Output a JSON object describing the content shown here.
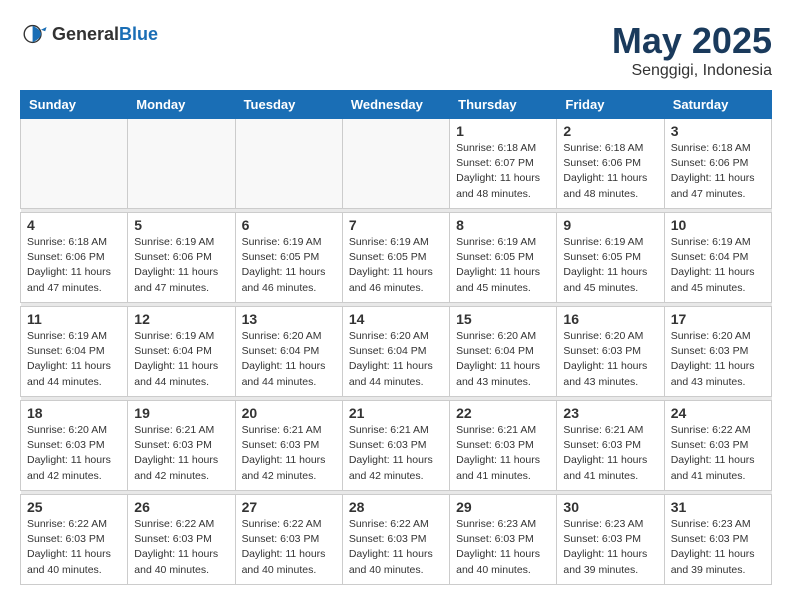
{
  "header": {
    "logo_general": "General",
    "logo_blue": "Blue",
    "month": "May 2025",
    "location": "Senggigi, Indonesia"
  },
  "weekdays": [
    "Sunday",
    "Monday",
    "Tuesday",
    "Wednesday",
    "Thursday",
    "Friday",
    "Saturday"
  ],
  "weeks": [
    {
      "days": [
        {
          "num": "",
          "info": ""
        },
        {
          "num": "",
          "info": ""
        },
        {
          "num": "",
          "info": ""
        },
        {
          "num": "",
          "info": ""
        },
        {
          "num": "1",
          "info": "Sunrise: 6:18 AM\nSunset: 6:07 PM\nDaylight: 11 hours\nand 48 minutes."
        },
        {
          "num": "2",
          "info": "Sunrise: 6:18 AM\nSunset: 6:06 PM\nDaylight: 11 hours\nand 48 minutes."
        },
        {
          "num": "3",
          "info": "Sunrise: 6:18 AM\nSunset: 6:06 PM\nDaylight: 11 hours\nand 47 minutes."
        }
      ]
    },
    {
      "days": [
        {
          "num": "4",
          "info": "Sunrise: 6:18 AM\nSunset: 6:06 PM\nDaylight: 11 hours\nand 47 minutes."
        },
        {
          "num": "5",
          "info": "Sunrise: 6:19 AM\nSunset: 6:06 PM\nDaylight: 11 hours\nand 47 minutes."
        },
        {
          "num": "6",
          "info": "Sunrise: 6:19 AM\nSunset: 6:05 PM\nDaylight: 11 hours\nand 46 minutes."
        },
        {
          "num": "7",
          "info": "Sunrise: 6:19 AM\nSunset: 6:05 PM\nDaylight: 11 hours\nand 46 minutes."
        },
        {
          "num": "8",
          "info": "Sunrise: 6:19 AM\nSunset: 6:05 PM\nDaylight: 11 hours\nand 45 minutes."
        },
        {
          "num": "9",
          "info": "Sunrise: 6:19 AM\nSunset: 6:05 PM\nDaylight: 11 hours\nand 45 minutes."
        },
        {
          "num": "10",
          "info": "Sunrise: 6:19 AM\nSunset: 6:04 PM\nDaylight: 11 hours\nand 45 minutes."
        }
      ]
    },
    {
      "days": [
        {
          "num": "11",
          "info": "Sunrise: 6:19 AM\nSunset: 6:04 PM\nDaylight: 11 hours\nand 44 minutes."
        },
        {
          "num": "12",
          "info": "Sunrise: 6:19 AM\nSunset: 6:04 PM\nDaylight: 11 hours\nand 44 minutes."
        },
        {
          "num": "13",
          "info": "Sunrise: 6:20 AM\nSunset: 6:04 PM\nDaylight: 11 hours\nand 44 minutes."
        },
        {
          "num": "14",
          "info": "Sunrise: 6:20 AM\nSunset: 6:04 PM\nDaylight: 11 hours\nand 44 minutes."
        },
        {
          "num": "15",
          "info": "Sunrise: 6:20 AM\nSunset: 6:04 PM\nDaylight: 11 hours\nand 43 minutes."
        },
        {
          "num": "16",
          "info": "Sunrise: 6:20 AM\nSunset: 6:03 PM\nDaylight: 11 hours\nand 43 minutes."
        },
        {
          "num": "17",
          "info": "Sunrise: 6:20 AM\nSunset: 6:03 PM\nDaylight: 11 hours\nand 43 minutes."
        }
      ]
    },
    {
      "days": [
        {
          "num": "18",
          "info": "Sunrise: 6:20 AM\nSunset: 6:03 PM\nDaylight: 11 hours\nand 42 minutes."
        },
        {
          "num": "19",
          "info": "Sunrise: 6:21 AM\nSunset: 6:03 PM\nDaylight: 11 hours\nand 42 minutes."
        },
        {
          "num": "20",
          "info": "Sunrise: 6:21 AM\nSunset: 6:03 PM\nDaylight: 11 hours\nand 42 minutes."
        },
        {
          "num": "21",
          "info": "Sunrise: 6:21 AM\nSunset: 6:03 PM\nDaylight: 11 hours\nand 42 minutes."
        },
        {
          "num": "22",
          "info": "Sunrise: 6:21 AM\nSunset: 6:03 PM\nDaylight: 11 hours\nand 41 minutes."
        },
        {
          "num": "23",
          "info": "Sunrise: 6:21 AM\nSunset: 6:03 PM\nDaylight: 11 hours\nand 41 minutes."
        },
        {
          "num": "24",
          "info": "Sunrise: 6:22 AM\nSunset: 6:03 PM\nDaylight: 11 hours\nand 41 minutes."
        }
      ]
    },
    {
      "days": [
        {
          "num": "25",
          "info": "Sunrise: 6:22 AM\nSunset: 6:03 PM\nDaylight: 11 hours\nand 40 minutes."
        },
        {
          "num": "26",
          "info": "Sunrise: 6:22 AM\nSunset: 6:03 PM\nDaylight: 11 hours\nand 40 minutes."
        },
        {
          "num": "27",
          "info": "Sunrise: 6:22 AM\nSunset: 6:03 PM\nDaylight: 11 hours\nand 40 minutes."
        },
        {
          "num": "28",
          "info": "Sunrise: 6:22 AM\nSunset: 6:03 PM\nDaylight: 11 hours\nand 40 minutes."
        },
        {
          "num": "29",
          "info": "Sunrise: 6:23 AM\nSunset: 6:03 PM\nDaylight: 11 hours\nand 40 minutes."
        },
        {
          "num": "30",
          "info": "Sunrise: 6:23 AM\nSunset: 6:03 PM\nDaylight: 11 hours\nand 39 minutes."
        },
        {
          "num": "31",
          "info": "Sunrise: 6:23 AM\nSunset: 6:03 PM\nDaylight: 11 hours\nand 39 minutes."
        }
      ]
    }
  ]
}
